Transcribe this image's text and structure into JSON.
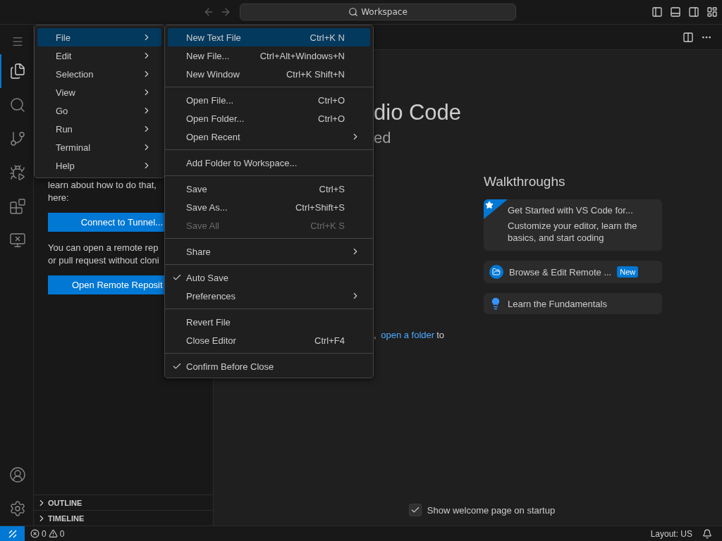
{
  "title_bar": {
    "search": "Workspace"
  },
  "activity_bar": [
    {
      "kind": "menu",
      "selected": false
    },
    {
      "kind": "explorer",
      "selected": true
    },
    {
      "kind": "search",
      "selected": false
    },
    {
      "kind": "source-control",
      "selected": false
    },
    {
      "kind": "run",
      "selected": false
    },
    {
      "kind": "extensions",
      "selected": false
    },
    {
      "kind": "remote",
      "selected": false
    }
  ],
  "activity_bar_bottom": [
    {
      "kind": "account",
      "selected": false
    },
    {
      "kind": "settings",
      "selected": false
    }
  ],
  "sidebar": {
    "intro_lines": [
      "learn about how to do that,",
      "here:"
    ],
    "connect_button": "Connect to Tunnel...",
    "remote_lines": [
      "You can open a remote rep",
      "or pull request without cloni"
    ],
    "open_remote_button": "Open Remote Reposit",
    "sections": [
      {
        "label": "OUTLINE",
        "expanded": false
      },
      {
        "label": "TIMELINE",
        "expanded": false
      }
    ]
  },
  "editor": {
    "title": "dio Code",
    "subtitle": "ed",
    "start_text": {
      "before": ",",
      "link": "open a folder",
      "after": "to"
    },
    "walkthroughs": {
      "heading": "Walkthroughs",
      "items": [
        {
          "kind": "featured",
          "title": "Get Started with VS Code for...",
          "description": "Customize your editor, learn the basics, and start coding"
        },
        {
          "kind": "remote",
          "title": "Browse & Edit Remote ...",
          "badge": "New"
        },
        {
          "kind": "learn",
          "title": "Learn the Fundamentals"
        }
      ]
    },
    "welcome_checkbox": {
      "label": "Show welcome page on startup",
      "checked": true
    }
  },
  "menu": {
    "items": [
      {
        "label": "File",
        "selected": true
      },
      {
        "label": "Edit",
        "selected": false
      },
      {
        "label": "Selection",
        "selected": false
      },
      {
        "label": "View",
        "selected": false
      },
      {
        "label": "Go",
        "selected": false
      },
      {
        "label": "Run",
        "selected": false
      },
      {
        "label": "Terminal",
        "selected": false
      },
      {
        "label": "Help",
        "selected": false
      }
    ]
  },
  "file_menu": {
    "groups": [
      [
        {
          "label": "New Text File",
          "shortcut": "Ctrl+K N",
          "selected": true,
          "checked": false,
          "disabled": false,
          "submenu": false
        },
        {
          "label": "New File...",
          "shortcut": "Ctrl+Alt+Windows+N",
          "selected": false,
          "checked": false,
          "disabled": false,
          "submenu": false
        },
        {
          "label": "New Window",
          "shortcut": "Ctrl+K Shift+N",
          "selected": false,
          "checked": false,
          "disabled": false,
          "submenu": false
        }
      ],
      [
        {
          "label": "Open File...",
          "shortcut": "Ctrl+O",
          "selected": false,
          "checked": false,
          "disabled": false,
          "submenu": false
        },
        {
          "label": "Open Folder...",
          "shortcut": "Ctrl+O",
          "selected": false,
          "checked": false,
          "disabled": false,
          "submenu": false
        },
        {
          "label": "Open Recent",
          "selected": false,
          "checked": false,
          "disabled": false,
          "submenu": true
        }
      ],
      [
        {
          "label": "Add Folder to Workspace...",
          "selected": false,
          "checked": false,
          "disabled": false,
          "submenu": false
        }
      ],
      [
        {
          "label": "Save",
          "shortcut": "Ctrl+S",
          "selected": false,
          "checked": false,
          "disabled": false,
          "submenu": false
        },
        {
          "label": "Save As...",
          "shortcut": "Ctrl+Shift+S",
          "selected": false,
          "checked": false,
          "disabled": false,
          "submenu": false
        },
        {
          "label": "Save All",
          "shortcut": "Ctrl+K S",
          "selected": false,
          "checked": false,
          "disabled": true,
          "submenu": false
        }
      ],
      [
        {
          "label": "Share",
          "selected": false,
          "checked": false,
          "disabled": false,
          "submenu": true
        }
      ],
      [
        {
          "label": "Auto Save",
          "selected": false,
          "checked": true,
          "disabled": false,
          "submenu": false
        },
        {
          "label": "Preferences",
          "selected": false,
          "checked": false,
          "disabled": false,
          "submenu": true
        }
      ],
      [
        {
          "label": "Revert File",
          "selected": false,
          "checked": false,
          "disabled": false,
          "submenu": false
        },
        {
          "label": "Close Editor",
          "shortcut": "Ctrl+F4",
          "selected": false,
          "checked": false,
          "disabled": false,
          "submenu": false
        }
      ],
      [
        {
          "label": "Confirm Before Close",
          "selected": false,
          "checked": true,
          "disabled": false,
          "submenu": false
        }
      ]
    ]
  },
  "status_bar": {
    "errors": "0",
    "warnings": "0",
    "layout": "Layout: US"
  }
}
